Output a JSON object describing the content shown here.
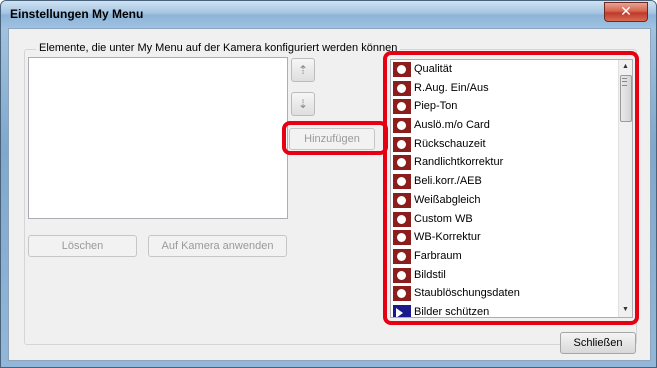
{
  "window": {
    "title": "Einstellungen My Menu",
    "close_label": "✕"
  },
  "group": {
    "label": "Elemente, die unter My Menu auf der Kamera konfiguriert werden können"
  },
  "buttons": {
    "move_up_icon": "move-up-icon",
    "move_down_icon": "move-down-icon",
    "add": "Hinzufügen",
    "delete": "Löschen",
    "apply": "Auf Kamera anwenden",
    "close": "Schließen"
  },
  "menu_items": [
    {
      "label": "Qualität",
      "icon": "camera-red-icon"
    },
    {
      "label": "R.Aug. Ein/Aus",
      "icon": "camera-red-icon"
    },
    {
      "label": "Piep-Ton",
      "icon": "camera-red-icon"
    },
    {
      "label": "Auslö.m/o Card",
      "icon": "camera-red-icon"
    },
    {
      "label": "Rückschauzeit",
      "icon": "camera-red-icon"
    },
    {
      "label": "Randlichtkorrektur",
      "icon": "camera-red-icon"
    },
    {
      "label": "Beli.korr./AEB",
      "icon": "camera-red-icon"
    },
    {
      "label": "Weißabgleich",
      "icon": "camera-red-icon"
    },
    {
      "label": "Custom WB",
      "icon": "camera-red-icon"
    },
    {
      "label": "WB-Korrektur",
      "icon": "camera-red-icon"
    },
    {
      "label": "Farbraum",
      "icon": "camera-red-icon"
    },
    {
      "label": "Bildstil",
      "icon": "camera-red-icon"
    },
    {
      "label": "Staublöschungsdaten",
      "icon": "camera-red-icon"
    },
    {
      "label": "Bilder schützen",
      "icon": "playback-blue-icon"
    }
  ],
  "colors": {
    "highlight": "#e60012",
    "camera_icon": "#8b1d1d",
    "playback_icon": "#1a1a8c"
  }
}
